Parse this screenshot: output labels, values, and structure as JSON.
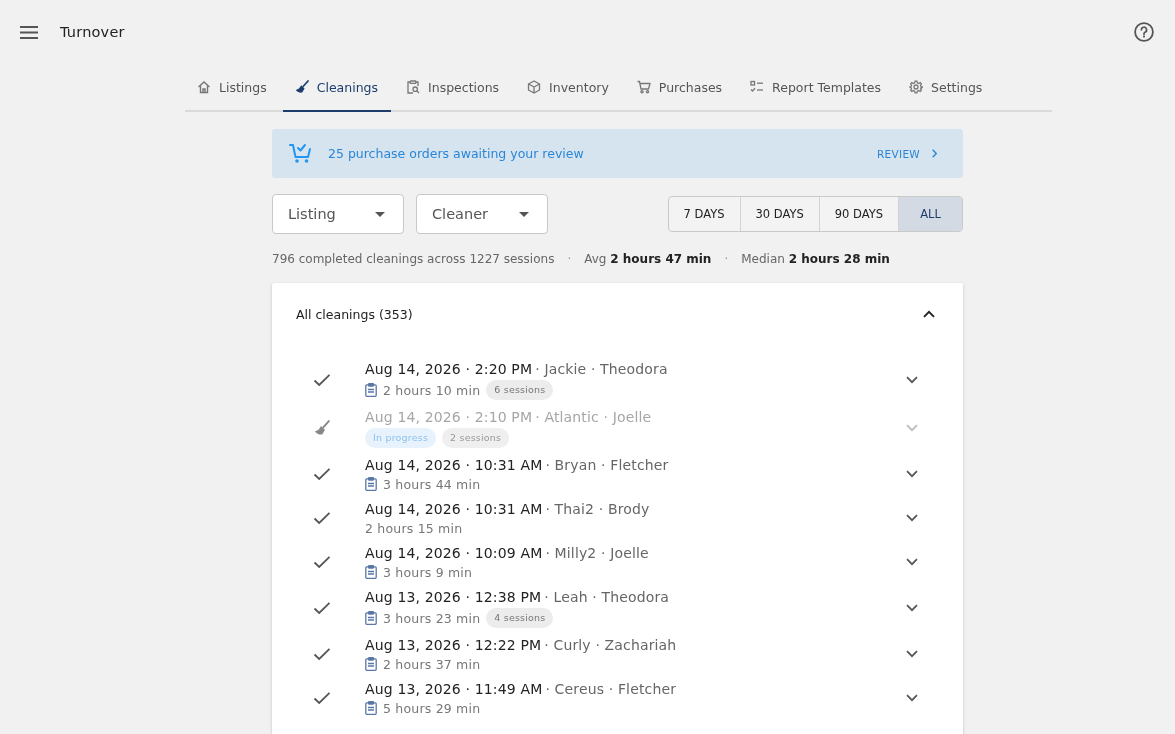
{
  "app_bar": {
    "title": "Turnover"
  },
  "tabs": [
    {
      "label": "Listings",
      "selected": false
    },
    {
      "label": "Cleanings",
      "selected": true
    },
    {
      "label": "Inspections",
      "selected": false
    },
    {
      "label": "Inventory",
      "selected": false
    },
    {
      "label": "Purchases",
      "selected": false
    },
    {
      "label": "Report Templates",
      "selected": false
    },
    {
      "label": "Settings",
      "selected": false
    }
  ],
  "banner": {
    "message": "25 purchase orders awaiting your review",
    "action": "REVIEW"
  },
  "filters": [
    {
      "label": "Listing"
    },
    {
      "label": "Cleaner"
    }
  ],
  "ranges": [
    {
      "label": "7 DAYS",
      "selected": false
    },
    {
      "label": "30 DAYS",
      "selected": false
    },
    {
      "label": "90 DAYS",
      "selected": false
    },
    {
      "label": "ALL",
      "selected": true
    }
  ],
  "stats": [
    {
      "kind": "text",
      "text": "796 completed cleanings across 1227 sessions"
    },
    {
      "kind": "separator",
      "text": "·"
    },
    {
      "kind": "text",
      "text": "Avg **2 hours 47 min**"
    },
    {
      "kind": "separator",
      "text": "·"
    },
    {
      "kind": "text",
      "text": "Median **2 hours 28 min**"
    }
  ],
  "cleanings": {
    "title": "All cleanings (353)",
    "expanded": true,
    "rows": [
      {
        "kind": "completed",
        "date": "Aug 14, 2026 · 2:20 PM",
        "details": "· Jackie · Theodora",
        "report": true,
        "duration": "2 hours 10 min",
        "badges": [
          {
            "kind": "count",
            "label": "6 sessions"
          }
        ]
      },
      {
        "kind": "in_progress",
        "date": "Aug 14, 2026 · 2:10 PM",
        "details": "· Atlantic · Joelle",
        "report": false,
        "badges": [
          {
            "kind": "status",
            "label": "In progress"
          },
          {
            "kind": "count",
            "label": "2 sessions"
          }
        ]
      },
      {
        "kind": "completed",
        "date": "Aug 14, 2026 · 10:31 AM",
        "details": "· Bryan · Fletcher",
        "report": true,
        "duration": "3 hours 44 min",
        "badges": []
      },
      {
        "kind": "completed",
        "date": "Aug 14, 2026 · 10:31 AM",
        "details": "· Thai2 · Brody",
        "report": false,
        "duration": "2 hours 15 min",
        "badges": []
      },
      {
        "kind": "completed",
        "date": "Aug 14, 2026 · 10:09 AM",
        "details": "· Milly2 · Joelle",
        "report": true,
        "duration": "3 hours 9 min",
        "badges": []
      },
      {
        "kind": "completed",
        "date": "Aug 13, 2026 · 12:38 PM",
        "details": "· Leah · Theodora",
        "report": true,
        "duration": "3 hours 23 min",
        "badges": [
          {
            "kind": "count",
            "label": "4 sessions"
          }
        ]
      },
      {
        "kind": "completed",
        "date": "Aug 13, 2026 · 12:22 PM",
        "details": "· Curly · Zachariah",
        "report": true,
        "duration": "2 hours 37 min",
        "badges": []
      },
      {
        "kind": "completed",
        "date": "Aug 13, 2026 · 11:49 AM",
        "details": "· Cereus · Fletcher",
        "report": true,
        "duration": "5 hours 29 min",
        "badges": []
      }
    ]
  }
}
